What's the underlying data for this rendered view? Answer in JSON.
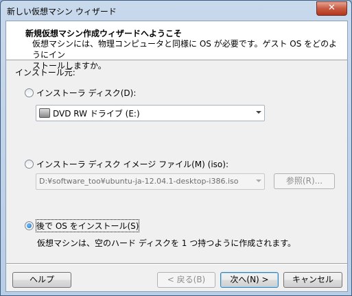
{
  "window": {
    "title": "新しい仮想マシン ウィザード",
    "close_label": "✕"
  },
  "header": {
    "title": "新規仮想マシン作成ウィザードへようこそ",
    "desc_line1": "仮想マシンには、物理コンピュータと同様に OS が必要です。ゲスト OS をどのようにイン",
    "desc_line2": "ストールしますか。"
  },
  "source_label": "インストール元:",
  "options": {
    "disc": {
      "label": "インストーラ ディスク(D):",
      "selected": false,
      "drive_value": "DVD RW ドライブ (E:)"
    },
    "iso": {
      "label": "インストーラ ディスク イメージ ファイル(M) (iso):",
      "selected": false,
      "path_value": "D:¥software_too¥ubuntu-ja-12.04.1-desktop-i386.iso",
      "browse_label": "参照(R)..."
    },
    "later": {
      "label": "後で OS をインストール(S)",
      "selected": true,
      "description": "仮想マシンは、空のハード ディスクを 1 つ持つように作成されます。"
    }
  },
  "footer": {
    "help_label": "ヘルプ",
    "back_label": "< 戻る(B)",
    "next_label": "次へ(N) >",
    "cancel_label": "キャンセル"
  }
}
